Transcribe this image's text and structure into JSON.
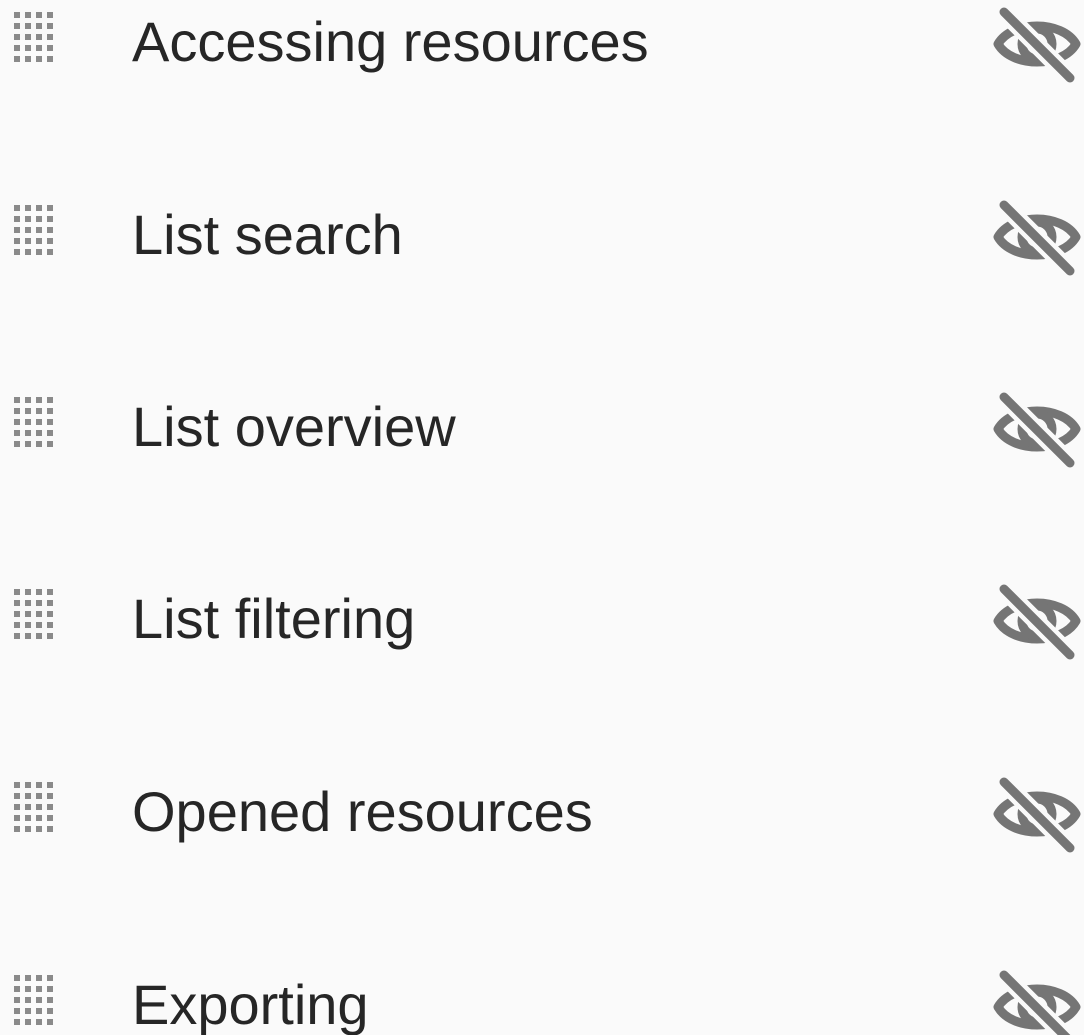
{
  "colors": {
    "background": "#fafafa",
    "text": "#262626",
    "icon": "#757575",
    "handle": "#8a8a8a"
  },
  "items": [
    {
      "label": "Accessing resources",
      "visibility_icon": "visibility-off-icon",
      "hidden": true
    },
    {
      "label": "List search",
      "visibility_icon": "visibility-off-icon",
      "hidden": true
    },
    {
      "label": "List overview",
      "visibility_icon": "visibility-off-icon",
      "hidden": true
    },
    {
      "label": "List filtering",
      "visibility_icon": "visibility-off-icon",
      "hidden": true
    },
    {
      "label": "Opened resources",
      "visibility_icon": "visibility-off-icon",
      "hidden": true
    },
    {
      "label": "Exporting",
      "visibility_icon": "visibility-off-icon",
      "hidden": true
    }
  ]
}
